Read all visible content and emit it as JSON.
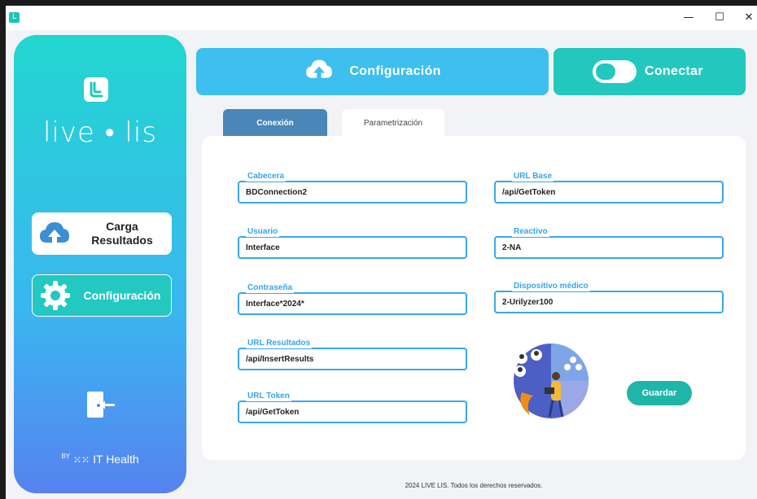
{
  "window": {
    "app_icon": "L",
    "minimize_glyph": "—",
    "maximize_glyph": "☐",
    "close_glyph": "✕"
  },
  "sidebar": {
    "brand_left": "live",
    "brand_dot": "•",
    "brand_right": "lis",
    "items": [
      {
        "label_line1": "Carga",
        "label_line2": "Resultados",
        "icon": "cloud-upload-icon",
        "active": false
      },
      {
        "label": "Configuración",
        "icon": "gear-icon",
        "active": true
      }
    ],
    "logout_icon": "logout-door-icon",
    "footer": {
      "by": "BY",
      "mark": "⁙⁙",
      "company": "IT Health"
    }
  },
  "header": {
    "config_label": "Configuración",
    "connect_label": "Conectar"
  },
  "tabs": [
    {
      "label": "Conexión",
      "active": true
    },
    {
      "label": "Parametrización",
      "active": false
    }
  ],
  "form": {
    "cabecera": {
      "label": "Cabecera",
      "value": "BDConnection2"
    },
    "usuario": {
      "label": "Usuario",
      "value": "Interface"
    },
    "contrasena": {
      "label": "Contraseña",
      "value": "Interface*2024*"
    },
    "url_resultados": {
      "label": "URL Resultados",
      "value": "/api/InsertResults"
    },
    "url_token": {
      "label": "URL Token",
      "value": "/api/GetToken"
    },
    "url_base": {
      "label": "URL Base",
      "value": "/api/GetToken"
    },
    "reactivo": {
      "label": "Reactivo",
      "value": "2-NA"
    },
    "dispositivo": {
      "label": "Dispositivo médico",
      "value": "2-Urilyzer100"
    },
    "save_label": "Guardar"
  },
  "footer": {
    "copyright": "2024 LIVE LIS. Todos los derechos reservados."
  },
  "colors": {
    "sidebar_top": "#22d6d0",
    "sidebar_bottom": "#5682f0",
    "accent_blue": "#3dbff0",
    "accent_teal": "#22c7bd",
    "tab_active": "#4a86b8",
    "field_border": "#3aa6ea"
  }
}
